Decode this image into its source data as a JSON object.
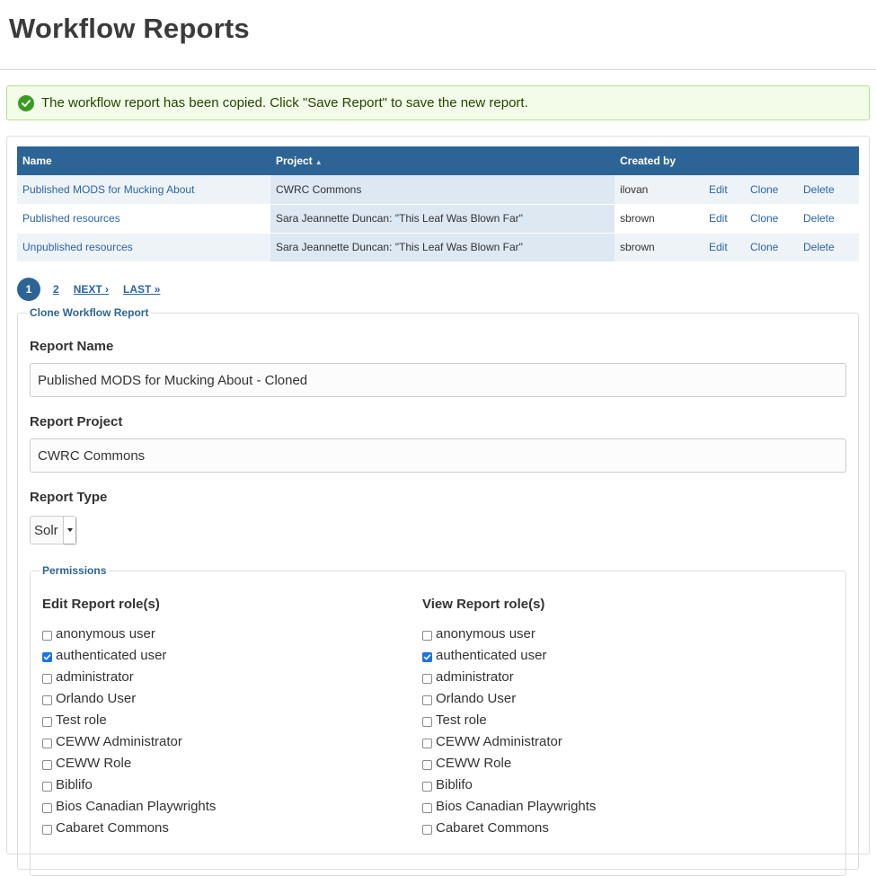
{
  "page": {
    "title": "Workflow Reports"
  },
  "status_message": "The workflow report has been copied. Click \"Save Report\" to save the new report.",
  "table": {
    "headers": {
      "name": "Name",
      "project": "Project",
      "created_by": "Created by"
    },
    "rows": [
      {
        "name": "Published MODS for Mucking About",
        "project": "CWRC Commons",
        "created_by": "ilovan",
        "edit": "Edit",
        "clone": "Clone",
        "delete": "Delete"
      },
      {
        "name": "Published resources",
        "project": "Sara Jeannette Duncan: \"This Leaf Was Blown Far\"",
        "created_by": "sbrown",
        "edit": "Edit",
        "clone": "Clone",
        "delete": "Delete"
      },
      {
        "name": "Unpublished resources",
        "project": "Sara Jeannette Duncan: \"This Leaf Was Blown Far\"",
        "created_by": "sbrown",
        "edit": "Edit",
        "clone": "Clone",
        "delete": "Delete"
      }
    ]
  },
  "pager": {
    "current": "1",
    "page2": "2",
    "next": "NEXT ›",
    "last": "LAST »"
  },
  "clone_form": {
    "legend": "Clone Workflow Report",
    "report_name_label": "Report Name",
    "report_name_value": "Published MODS for Mucking About - Cloned",
    "report_project_label": "Report Project",
    "report_project_value": "CWRC Commons",
    "report_type_label": "Report Type",
    "report_type_value": "Solr",
    "permissions": {
      "legend": "Permissions",
      "edit_title": "Edit Report role(s)",
      "view_title": "View Report role(s)",
      "roles": [
        {
          "label": "anonymous user",
          "edit": false,
          "view": false
        },
        {
          "label": "authenticated user",
          "edit": true,
          "view": true
        },
        {
          "label": "administrator",
          "edit": false,
          "view": false
        },
        {
          "label": "Orlando User",
          "edit": false,
          "view": false
        },
        {
          "label": "Test role",
          "edit": false,
          "view": false
        },
        {
          "label": "CEWW Administrator",
          "edit": false,
          "view": false
        },
        {
          "label": "CEWW Role",
          "edit": false,
          "view": false
        },
        {
          "label": "Biblifo",
          "edit": false,
          "view": false
        },
        {
          "label": "Bios Canadian Playwrights",
          "edit": false,
          "view": false
        },
        {
          "label": "Cabaret Commons",
          "edit": false,
          "view": false
        }
      ]
    }
  },
  "colors": {
    "header_blue": "#2d6496",
    "link_blue": "#2a64a8",
    "success_green": "#3a9b22"
  }
}
